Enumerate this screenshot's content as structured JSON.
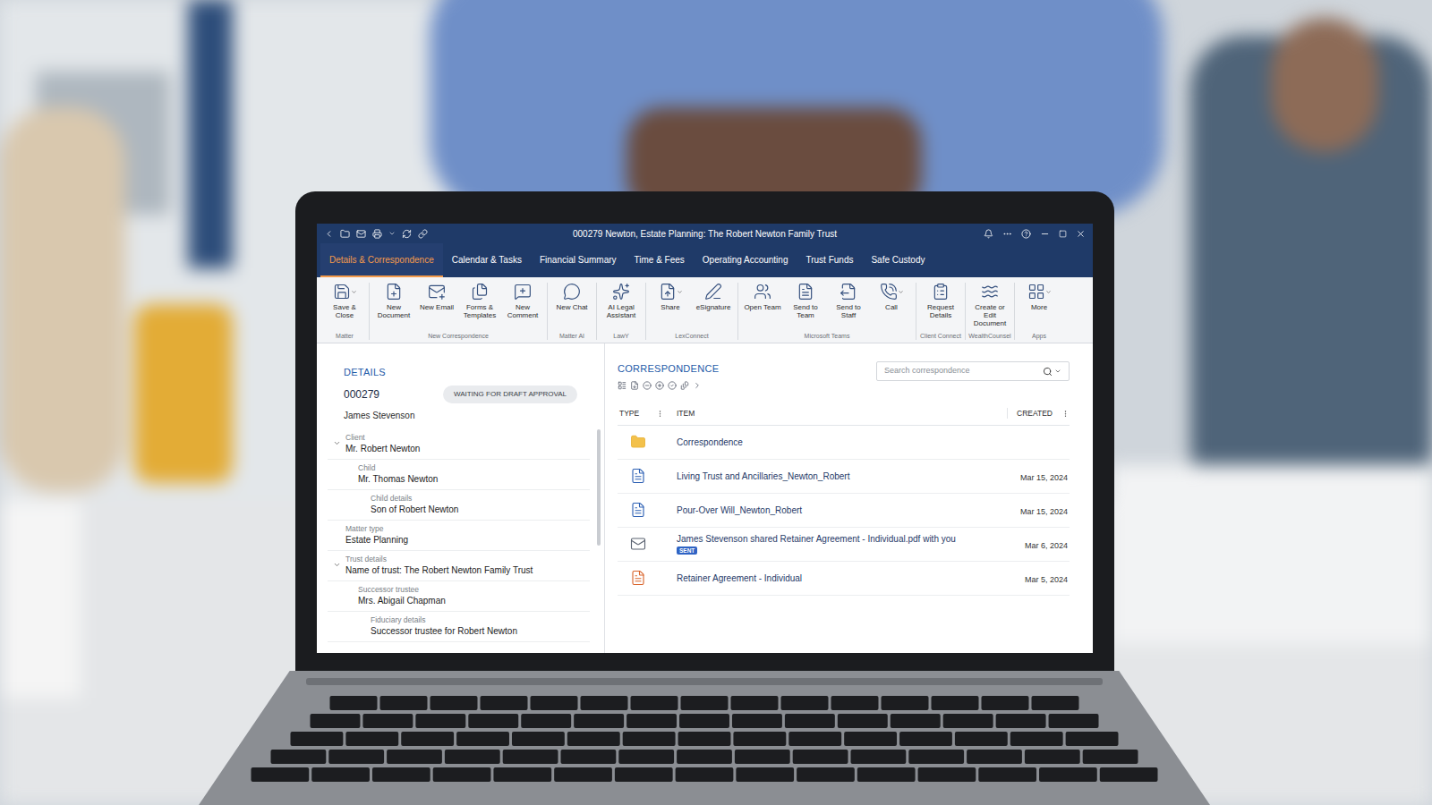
{
  "window": {
    "title": "000279 Newton, Estate Planning: The Robert Newton Family Trust"
  },
  "tabs": [
    {
      "label": "Details & Correspondence",
      "selected": true
    },
    {
      "label": "Calendar & Tasks",
      "selected": false
    },
    {
      "label": "Financial Summary",
      "selected": false
    },
    {
      "label": "Time & Fees",
      "selected": false
    },
    {
      "label": "Operating Accounting",
      "selected": false
    },
    {
      "label": "Trust Funds",
      "selected": false
    },
    {
      "label": "Safe Custody",
      "selected": false
    }
  ],
  "ribbon": {
    "groups": [
      {
        "label": "Matter",
        "buttons": [
          {
            "label": "Save & Close",
            "dropdown": true
          }
        ]
      },
      {
        "label": "New Correspondence",
        "buttons": [
          {
            "label": "New Document",
            "dropdown": false
          },
          {
            "label": "New Email",
            "dropdown": false
          },
          {
            "label": "Forms & Templates",
            "dropdown": false
          },
          {
            "label": "New Comment",
            "dropdown": false
          }
        ]
      },
      {
        "label": "Matter AI",
        "buttons": [
          {
            "label": "New Chat",
            "dropdown": false
          }
        ]
      },
      {
        "label": "LawY",
        "buttons": [
          {
            "label": "AI Legal Assistant",
            "dropdown": false
          }
        ]
      },
      {
        "label": "LexConnect",
        "buttons": [
          {
            "label": "Share",
            "dropdown": true
          },
          {
            "label": "eSignature",
            "dropdown": false
          }
        ]
      },
      {
        "label": "Microsoft Teams",
        "buttons": [
          {
            "label": "Open Team",
            "dropdown": false
          },
          {
            "label": "Send to Team",
            "dropdown": false
          },
          {
            "label": "Send to Staff",
            "dropdown": false
          },
          {
            "label": "Call",
            "dropdown": true
          }
        ]
      },
      {
        "label": "Client Connect",
        "buttons": [
          {
            "label": "Request Details",
            "dropdown": false
          }
        ]
      },
      {
        "label": "WealthCounsel",
        "buttons": [
          {
            "label": "Create or Edit Document",
            "dropdown": false
          }
        ]
      },
      {
        "label": "Apps",
        "buttons": [
          {
            "label": "More",
            "dropdown": true
          }
        ]
      }
    ]
  },
  "details": {
    "heading": "DETAILS",
    "matter_number": "000279",
    "status": "WAITING FOR DRAFT APPROVAL",
    "responsible": "James Stevenson",
    "fields": [
      {
        "label": "Client",
        "value": "Mr. Robert Newton",
        "indent": 0,
        "expandable": true,
        "expanded": true
      },
      {
        "label": "Child",
        "value": "Mr. Thomas Newton",
        "indent": 1,
        "expandable": false,
        "expanded": false
      },
      {
        "label": "Child details",
        "value": "Son of Robert Newton",
        "indent": 2,
        "expandable": false,
        "expanded": false
      },
      {
        "label": "Matter type",
        "value": "Estate Planning",
        "indent": 0,
        "expandable": false,
        "expanded": false
      },
      {
        "label": "Trust details",
        "value": "Name of trust: The Robert Newton Family Trust",
        "indent": 0,
        "expandable": true,
        "expanded": true
      },
      {
        "label": "Successor trustee",
        "value": "Mrs. Abigail Chapman",
        "indent": 1,
        "expandable": false,
        "expanded": false
      },
      {
        "label": "Fiduciary details",
        "value": "Successor trustee for Robert Newton",
        "indent": 2,
        "expandable": false,
        "expanded": false
      }
    ]
  },
  "correspondence": {
    "heading": "CORRESPONDENCE",
    "search_placeholder": "Search correspondence",
    "columns": [
      "TYPE",
      "ITEM",
      "CREATED"
    ],
    "rows": [
      {
        "kind": "folder",
        "item": "Correspondence",
        "created": "",
        "badge": ""
      },
      {
        "kind": "word",
        "item": "Living Trust and Ancillaries_Newton_Robert",
        "created": "Mar 15, 2024",
        "badge": ""
      },
      {
        "kind": "word",
        "item": "Pour-Over Will_Newton_Robert",
        "created": "Mar 15, 2024",
        "badge": ""
      },
      {
        "kind": "email",
        "item": "James Stevenson shared Retainer Agreement - Individual.pdf with you",
        "created": "Mar 6, 2024",
        "badge": "SENT"
      },
      {
        "kind": "pdf",
        "item": "Retainer Agreement - Individual",
        "created": "Mar 5, 2024",
        "badge": ""
      }
    ]
  }
}
